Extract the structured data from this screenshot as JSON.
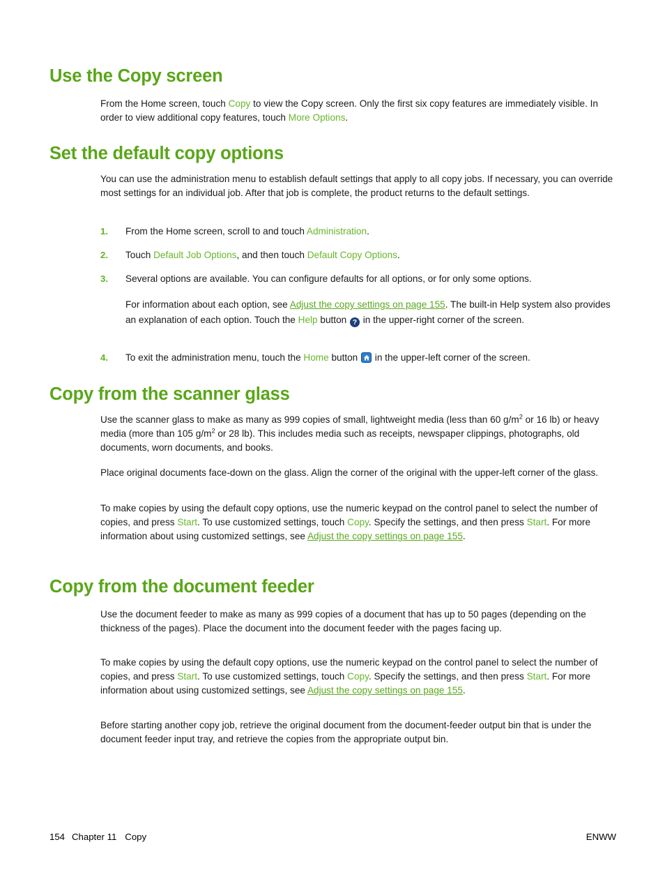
{
  "page": {
    "sections": [
      {
        "id": "use-copy-screen",
        "heading": "Use the Copy screen",
        "paragraph_parts": {
          "p1_a": "From the Home screen, touch ",
          "p1_ui1": "Copy",
          "p1_b": " to view the Copy screen. Only the first six copy features are immediately visible. In order to view additional copy features, touch ",
          "p1_ui2": "More Options",
          "p1_c": "."
        }
      },
      {
        "id": "set-default-copy-options",
        "heading": "Set the default copy options",
        "intro": "You can use the administration menu to establish default settings that apply to all copy jobs. If necessary, you can override most settings for an individual job. After that job is complete, the product returns to the default settings.",
        "steps": [
          {
            "number": "1.",
            "a": "From the Home screen, scroll to and touch ",
            "ui1": "Administration",
            "b": "."
          },
          {
            "number": "2.",
            "a": "Touch ",
            "ui1": "Default Job Options",
            "b": ", and then touch ",
            "ui2": "Default Copy Options",
            "c": "."
          },
          {
            "number": "3.",
            "a": "Several options are available. You can configure defaults for all options, or for only some options.",
            "sub_a": "For information about each option, see ",
            "sub_link": "Adjust the copy settings on page 155",
            "sub_b": ". The built-in Help system also provides an explanation of each option. Touch the ",
            "sub_ui": "Help",
            "sub_c": " button ",
            "sub_icon": "help-icon",
            "sub_d": " in the upper-right corner of the screen."
          },
          {
            "number": "4.",
            "a": "To exit the administration menu, touch the ",
            "ui1": "Home",
            "b": " button ",
            "icon": "home-icon",
            "c": " in the upper-left corner of the screen."
          }
        ]
      },
      {
        "id": "copy-from-scanner-glass",
        "heading": "Copy from the scanner glass",
        "p1": {
          "a": "Use the scanner glass to make as many as 999 copies of small, lightweight media (less than 60 g/m",
          "sup1": "2",
          "b": " or 16 lb) or heavy media (more than 105 g/m",
          "sup2": "2",
          "c": " or 28 lb). This includes media such as receipts, newspaper clippings, photographs, old documents, worn documents, and books."
        },
        "p2": "Place original documents face-down on the glass. Align the corner of the original with the upper-left corner of the glass.",
        "p3": {
          "a": "To make copies by using the default copy options, use the numeric keypad on the control panel to select the number of copies, and press ",
          "ui1": "Start",
          "b": ". To use customized settings, touch ",
          "ui2": "Copy",
          "c": ". Specify the settings, and then press ",
          "ui3": "Start",
          "d": ". For more information about using customized settings, see ",
          "link": "Adjust the copy settings on page 155",
          "e": "."
        }
      },
      {
        "id": "copy-from-document-feeder",
        "heading": "Copy from the document feeder",
        "p1": "Use the document feeder to make as many as 999 copies of a document that has up to 50 pages (depending on the thickness of the pages). Place the document into the document feeder with the pages facing up.",
        "p2": {
          "a": "To make copies by using the default copy options, use the numeric keypad on the control panel to select the number of copies, and press ",
          "ui1": "Start",
          "b": ". To use customized settings, touch ",
          "ui2": "Copy",
          "c": ". Specify the settings, and then press ",
          "ui3": "Start",
          "d": ". For more information about using customized settings, see ",
          "link": "Adjust the copy settings on page 155",
          "e": "."
        },
        "p3": "Before starting another copy job, retrieve the original document from the document-feeder output bin that is under the document feeder input tray, and retrieve the copies from the appropriate output bin."
      }
    ],
    "footer": {
      "page_number": "154",
      "chapter": "Chapter 11",
      "chapter_title": "Copy",
      "locale": "ENWW"
    },
    "colors": {
      "heading_green": "#59a618",
      "ui_term_green": "#68b62a",
      "link_green": "#5aa81e",
      "list_number_green": "#62b320",
      "help_icon_blue": "#1c3f78",
      "home_icon_blue": "#2d7fd0",
      "text_black": "#1a1a1a",
      "background": "#ffffff"
    }
  }
}
